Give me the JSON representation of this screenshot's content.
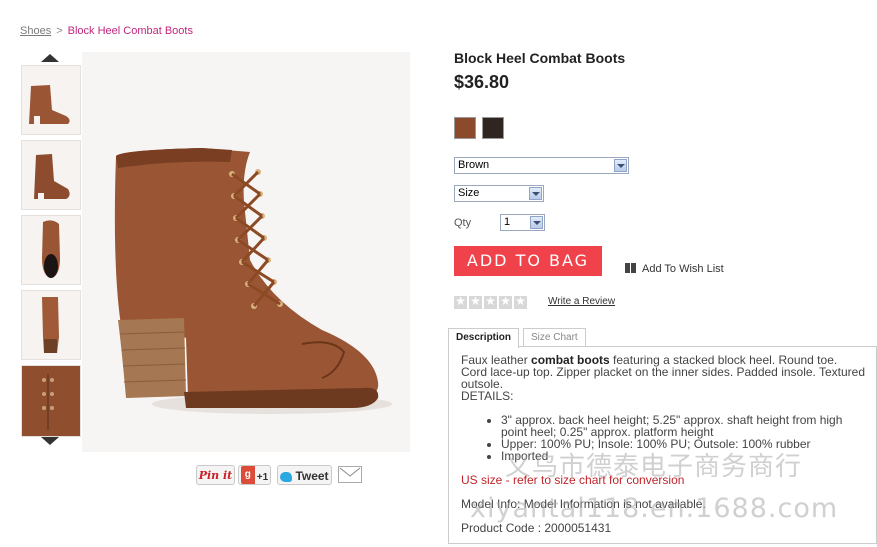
{
  "breadcrumb": {
    "parent": "Shoes",
    "separator": ">",
    "current": "Block Heel Combat Boots"
  },
  "product": {
    "title": "Block Heel Combat Boots",
    "price": "$36.80",
    "swatches": [
      {
        "color": "#8b4a2b"
      },
      {
        "color": "#2f2521"
      }
    ],
    "color_select": "Brown",
    "size_select": "Size",
    "qty_label": "Qty",
    "qty_value": "1",
    "add_to_bag": "ADD TO BAG",
    "wish_list": "Add To Wish List",
    "rating_stars": 0,
    "write_review": "Write a Review"
  },
  "social": {
    "pinterest": "Pin it",
    "gplus": "+1",
    "gplus_g": "g",
    "tweet": "Tweet"
  },
  "tabs": [
    "Description",
    "Size Chart"
  ],
  "description": {
    "intro_pre": "Faux leather ",
    "intro_bold": "combat boots",
    "intro_post": " featuring a stacked block heel. Round toe. Cord lace-up top. Zipper placket on the inner sides. Padded insole. Textured outsole.",
    "details_label": "DETAILS:",
    "bullets": [
      "3\" approx. back heel height; 5.25\" approx. shaft height from high point heel; 0.25\" approx. platform height",
      "Upper: 100% PU; Insole: 100% PU; Outsole: 100% rubber",
      "Imported"
    ],
    "size_note": "US size - refer to size chart for conversion",
    "model_info": "Model Info: Model Information is not available.",
    "product_code": "Product Code : 2000051431"
  },
  "watermark": {
    "line1": "义乌市德泰电子商务商行",
    "line2": "xiyantal118.en.1688.com"
  },
  "colors": {
    "accent": "#f0424a",
    "breadcrumb_current": "#c0267e",
    "notice": "#c0242a",
    "boot": "#9a5634"
  }
}
